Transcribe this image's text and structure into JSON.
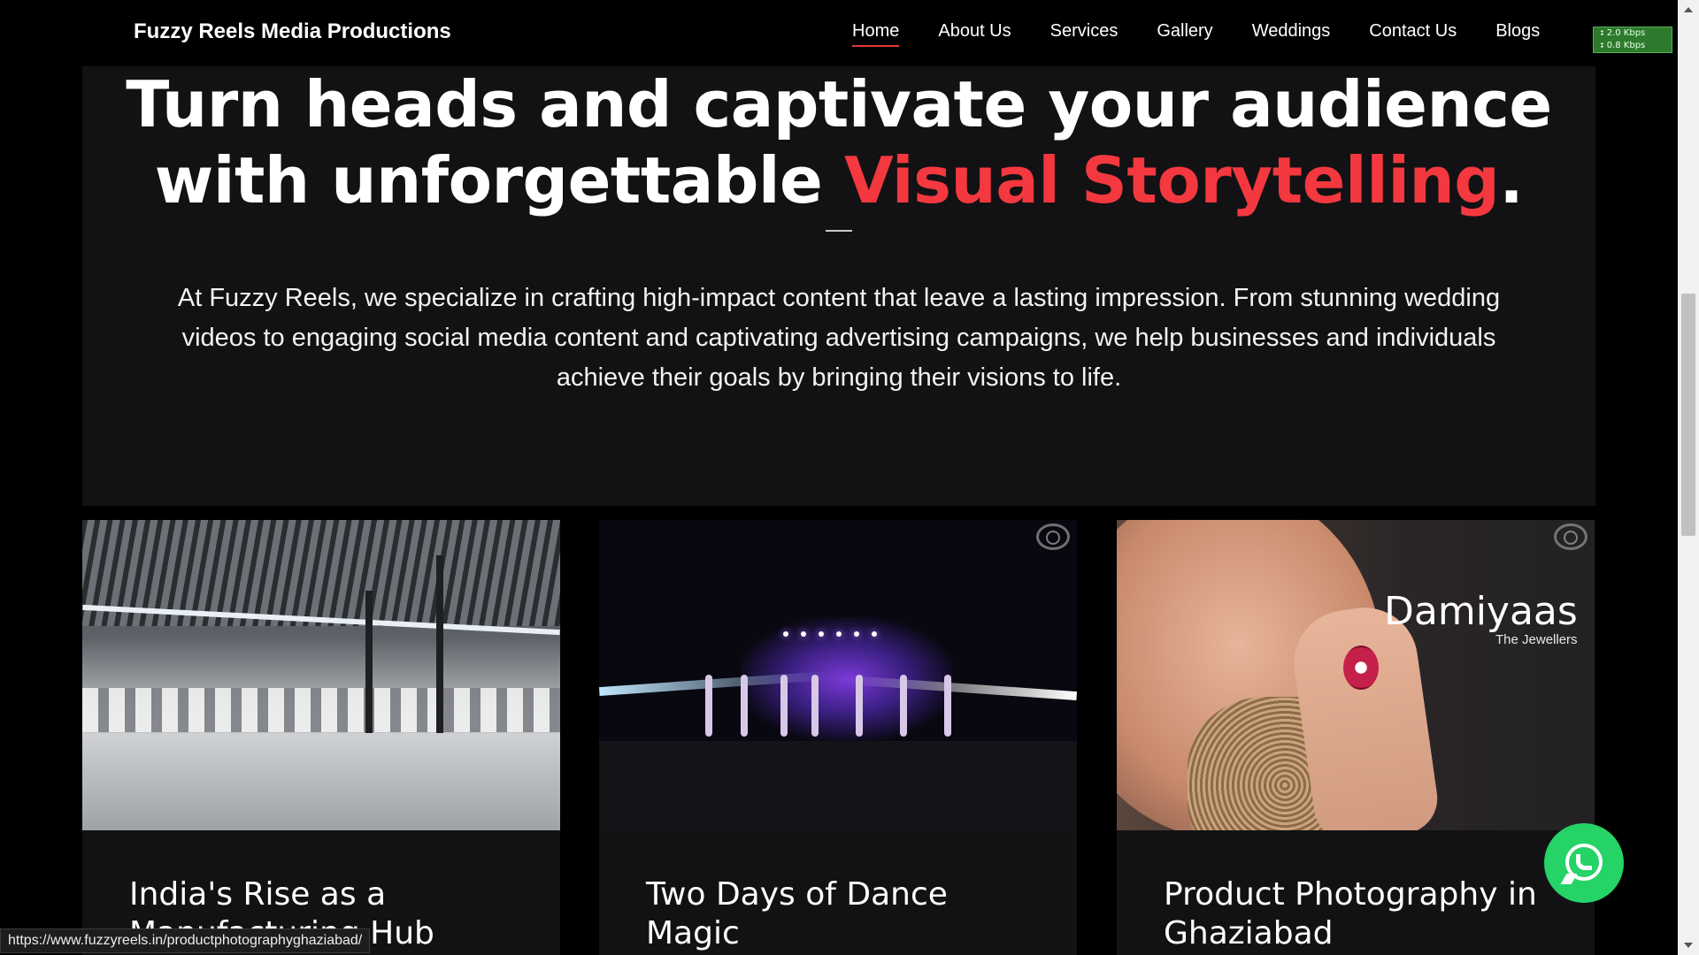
{
  "nav": {
    "brand": "Fuzzy Reels Media Productions",
    "links": [
      "Home",
      "About Us",
      "Services",
      "Gallery",
      "Weddings",
      "Contact Us",
      "Blogs"
    ],
    "active": "Home",
    "net_down": "2.0 Kbps",
    "net_up": "0.8 Kbps"
  },
  "hero": {
    "title_line1": "Turn heads and captivate your audience",
    "title_line2_pre": "with unforgettable ",
    "title_accent": "Visual Storytelling",
    "title_end": ".",
    "body": "At Fuzzy Reels, we specialize in crafting high-impact content that leave a lasting impression. From stunning wedding videos to engaging social media content and captivating advertising campaigns, we help businesses and individuals achieve their goals by bringing their visions to life."
  },
  "cards": [
    {
      "title": "India's Rise as a Manufacturing Hub"
    },
    {
      "title": "Two Days of Dance Magic"
    },
    {
      "title": "Product Photography in Ghaziabad",
      "image_brand": "Damiyaas",
      "image_brand_sub": "The Jewellers"
    }
  ],
  "statusbar": {
    "url": "https://www.fuzzyreels.in/productphotographyghaziabad/"
  },
  "colors": {
    "accent": "#f3383f",
    "whatsapp": "#25d366"
  },
  "icons": {
    "whatsapp": "whatsapp-icon",
    "brand_mark": "aperture-logo-icon"
  }
}
